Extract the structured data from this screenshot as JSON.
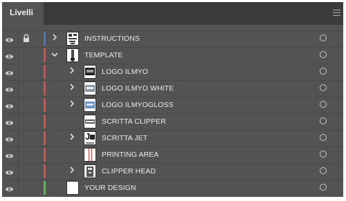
{
  "panel": {
    "tab_label": "Livelli",
    "icons": {
      "menu": "panel-menu-icon",
      "eye": "eye-icon",
      "lock": "lock-icon",
      "expand": "chevron-right-icon",
      "collapse": "chevron-down-icon",
      "target": "target-circle-icon"
    },
    "colors": {
      "blue": "#4b73c9",
      "red": "#e14a4a",
      "green": "#4cc24c"
    },
    "layers": [
      {
        "name": "INSTRUCTIONS",
        "level": 0,
        "locked": true,
        "expand": "right",
        "color": "#4b73c9",
        "thumb": "instructions"
      },
      {
        "name": "TEMPLATE",
        "level": 0,
        "locked": false,
        "expand": "down",
        "color": "#e14a4a",
        "thumb": "template"
      },
      {
        "name": "LOGO ILMYO",
        "level": 1,
        "locked": false,
        "expand": "right",
        "color": "#e14a4a",
        "thumb": "logo-dark"
      },
      {
        "name": "LOGO ILMYO WHITE",
        "level": 1,
        "locked": false,
        "expand": "right",
        "color": "#e14a4a",
        "thumb": "logo-light"
      },
      {
        "name": "LOGO ILMYOGLOSS",
        "level": 1,
        "locked": false,
        "expand": "right",
        "color": "#e14a4a",
        "thumb": "logo-gloss"
      },
      {
        "name": "SCRITTA CLIPPER",
        "level": 1,
        "locked": false,
        "expand": "none",
        "color": "#e14a4a",
        "thumb": "clipper-text"
      },
      {
        "name": "SCRITTA JET",
        "level": 1,
        "locked": false,
        "expand": "right",
        "color": "#e14a4a",
        "thumb": "jet"
      },
      {
        "name": "PRINTING AREA",
        "level": 1,
        "locked": false,
        "expand": "none",
        "color": "#e14a4a",
        "thumb": "printing"
      },
      {
        "name": "CLIPPER HEAD",
        "level": 1,
        "locked": false,
        "expand": "right",
        "color": "#e14a4a",
        "thumb": "head"
      },
      {
        "name": "YOUR DESIGN",
        "level": 0,
        "locked": false,
        "expand": "none",
        "color": "#4cc24c",
        "thumb": "blank"
      }
    ]
  }
}
